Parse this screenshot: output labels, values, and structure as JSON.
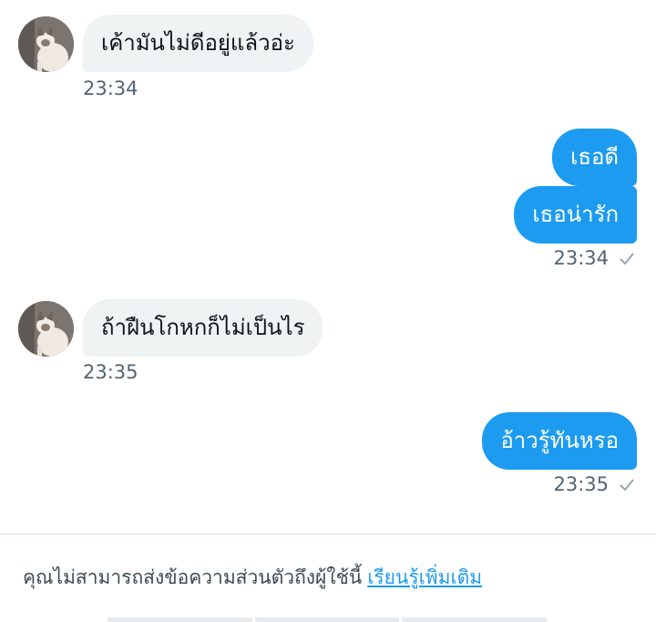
{
  "messages": [
    {
      "direction": "in",
      "text": "เค้ามันไม่ดีอยู่แล้วอ่ะ"
    },
    {
      "direction": "in",
      "time": "23:34"
    },
    {
      "direction": "out",
      "text": "เธอดี"
    },
    {
      "direction": "out",
      "text": "เธอน่ารัก",
      "time": "23:34"
    },
    {
      "direction": "in",
      "text": "ถ้าฝืนโกหกก็ไม่เป็นไร",
      "time": "23:35"
    },
    {
      "direction": "out",
      "text": "อ้าวรู้ทันหรอ",
      "time": "23:35"
    }
  ],
  "footer": {
    "notice": "คุณไม่สามารถส่งข้อความส่วนตัวถึงผู้ใช้นี้",
    "learn_more": "เรียนรู้เพิ่มเติม"
  },
  "icons": {
    "avatar": "cat-avatar",
    "sent_status": "check-icon"
  },
  "colors": {
    "outgoing_bubble": "#1d9bf0",
    "incoming_bubble": "#eff3f4",
    "link": "#1d9bf0"
  }
}
